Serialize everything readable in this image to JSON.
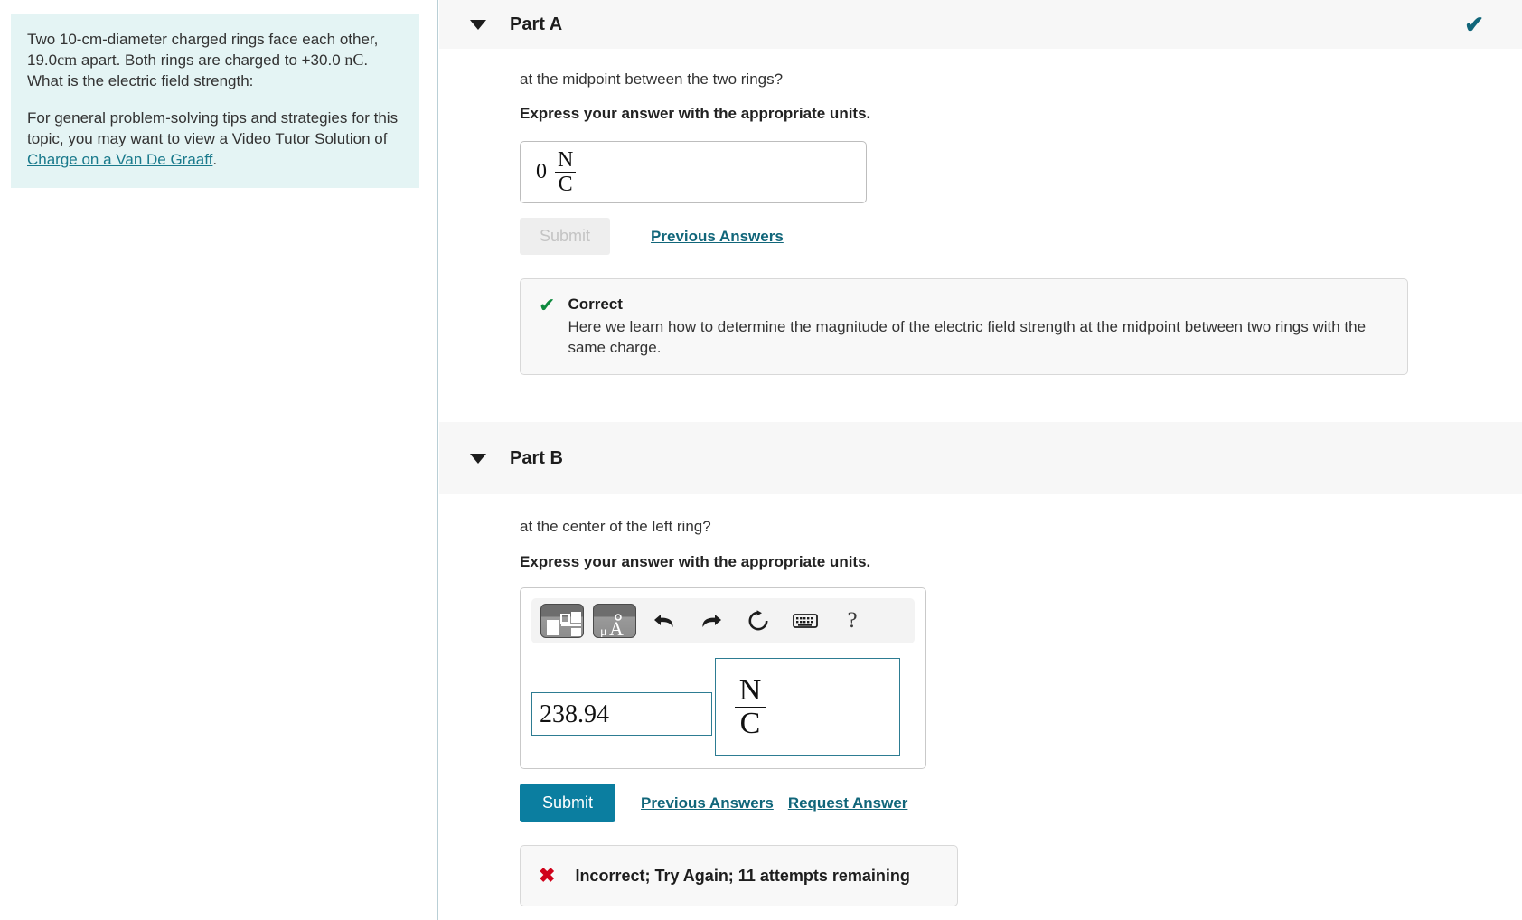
{
  "problem": {
    "statement_line1": "Two 10-cm-diameter charged rings face each other,",
    "statement_distance": "19.0",
    "statement_distance_unit": "cm",
    "statement_line2_mid": " apart. Both rings are charged to +30.0 ",
    "statement_charge_unit": "nC",
    "statement_line3": ". What is the electric field strength:",
    "tips_before_link": "For general problem-solving tips and strategies for this topic, you may want to view a Video Tutor Solution of ",
    "tips_link": "Charge on a Van De Graaff",
    "tips_after_link": "."
  },
  "part_a": {
    "title": "Part A",
    "status_icon": "check-icon",
    "question": "at the midpoint between the two rings?",
    "instruction": "Express your answer with the appropriate units.",
    "answer_value": "0",
    "answer_unit_numerator": "N",
    "answer_unit_denominator": "C",
    "submit_label": "Submit",
    "previous_answers_label": "Previous Answers",
    "feedback": {
      "icon": "check-icon",
      "title": "Correct",
      "text": "Here we learn how to determine the magnitude of the electric field strength at the midpoint between two rings with the same charge."
    }
  },
  "part_b": {
    "title": "Part B",
    "question": "at the center of the left ring?",
    "instruction": "Express your answer with the appropriate units.",
    "toolbar": {
      "templates_label": "math-templates",
      "units_label": "μÅ",
      "undo_label": "undo",
      "redo_label": "redo",
      "reset_label": "reset",
      "keyboard_label": "keyboard",
      "help_label": "?"
    },
    "answer_value": "238.94",
    "answer_unit_numerator": "N",
    "answer_unit_denominator": "C",
    "submit_label": "Submit",
    "previous_answers_label": "Previous Answers",
    "request_answer_label": "Request Answer",
    "feedback": {
      "icon": "cross-icon",
      "text": "Incorrect; Try Again; 11 attempts remaining"
    }
  },
  "colors": {
    "problem_bg": "#e4f4f4",
    "link": "#1a7a8c",
    "primary_button": "#0b7ea0",
    "correct_green": "#0e8a3e",
    "incorrect_red": "#d0021b",
    "status_check": "#11667a",
    "field_border": "#2d7c92"
  }
}
